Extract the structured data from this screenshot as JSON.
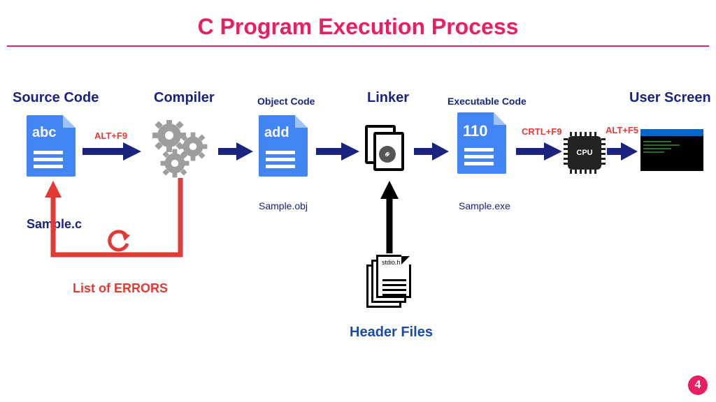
{
  "title": "C Program Execution Process",
  "stages": {
    "source": {
      "label": "Source Code",
      "icon_text": "abc",
      "file": "Sample.c"
    },
    "compiler": {
      "label": "Compiler"
    },
    "object": {
      "label": "Object Code",
      "icon_text": "add",
      "file": "Sample.obj"
    },
    "linker": {
      "label": "Linker"
    },
    "executable": {
      "label": "Executable Code",
      "icon_text": "110",
      "file": "Sample.exe"
    },
    "cpu": {
      "label": "CPU"
    },
    "screen": {
      "label": "User Screen"
    }
  },
  "shortcuts": {
    "compile": "ALT+F9",
    "run": "CRTL+F9",
    "output": "ALT+F5"
  },
  "errors_label": "List of ERRORS",
  "header_files": {
    "label": "Header Files",
    "example": "stdio.h"
  },
  "page_number": "4"
}
